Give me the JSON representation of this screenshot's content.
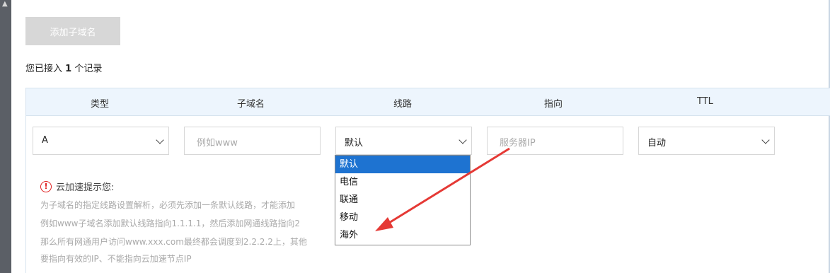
{
  "toolbar": {
    "add_subdomain_label": "添加子域名"
  },
  "record_count": {
    "prefix": "您已接入",
    "count": "1",
    "suffix": "个记录"
  },
  "table": {
    "headers": [
      "类型",
      "子域名",
      "线路",
      "指向",
      "TTL"
    ],
    "type_value": "A",
    "subdomain_placeholder": "例如www",
    "route_value": "默认",
    "target_placeholder": "服务器IP",
    "ttl_value": "自动"
  },
  "route_options": [
    "默认",
    "电信",
    "联通",
    "移动",
    "海外"
  ],
  "tip": {
    "title": "云加速提示您:",
    "lines": [
      "为子域名的指定线路设置解析，必须先添加一条默认线路，才能添加",
      "例如www子域名添加默认线路指向1.1.1.1，然后添加网通线路指向2",
      "那么所有网通用户访问www.xxx.com最终都会调度到2.2.2.2上，其他",
      "要指向有效的IP、不能指向云加速节点IP"
    ]
  },
  "colors": {
    "selected_option": "#1e73d1",
    "header_bg": "#edf5fd",
    "arrow": "#e53935",
    "warn": "#e02020"
  }
}
